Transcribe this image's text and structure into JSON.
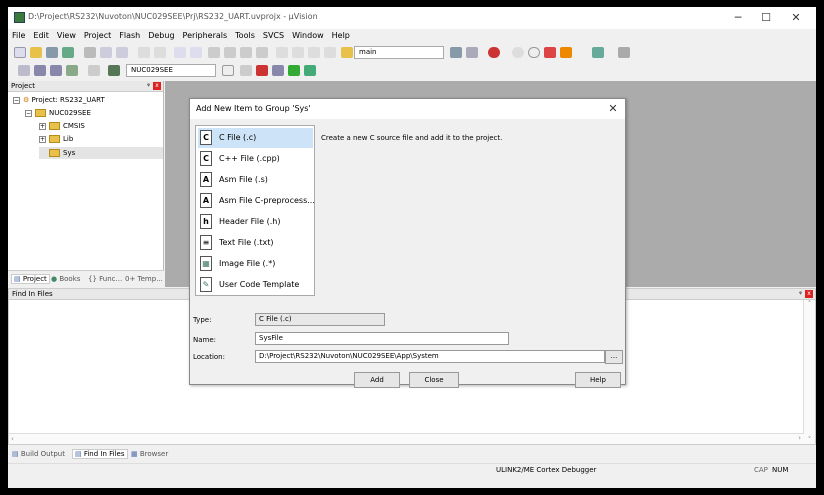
{
  "window": {
    "title": "D:\\Project\\RS232\\Nuvoton\\NUC029SEE\\Prj\\RS232_UART.uvprojx - µVision"
  },
  "menu": [
    "File",
    "Edit",
    "View",
    "Project",
    "Flash",
    "Debug",
    "Peripherals",
    "Tools",
    "SVCS",
    "Window",
    "Help"
  ],
  "toolbar": {
    "find_combo": "main",
    "target_combo": "NUC029SEE"
  },
  "project_pane": {
    "title": "Project",
    "root": "Project: RS232_UART",
    "target": "NUC029SEE",
    "groups": [
      "CMSIS",
      "Lib",
      "Sys"
    ]
  },
  "left_tabs": [
    "Project",
    "Books",
    "{} Func...",
    "0+ Temp..."
  ],
  "find_pane": {
    "title": "Find In Files"
  },
  "bottom_tabs": [
    "Build Output",
    "Find In Files",
    "Browser"
  ],
  "status": {
    "debugger": "ULINK2/ME Cortex Debugger",
    "caps": "CAP",
    "num": "NUM"
  },
  "dialog": {
    "title": "Add New Item to Group 'Sys'",
    "items": [
      {
        "icon": "C",
        "label": "C File (.c)"
      },
      {
        "icon": "C",
        "label": "C++ File (.cpp)"
      },
      {
        "icon": "A",
        "label": "Asm File (.s)"
      },
      {
        "icon": "A",
        "label": "Asm File C-preprocess..."
      },
      {
        "icon": "h",
        "label": "Header File (.h)"
      },
      {
        "icon": "≡",
        "label": "Text File (.txt)"
      },
      {
        "icon": "▦",
        "label": "Image File (.*)"
      },
      {
        "icon": "✎",
        "label": "User Code Template"
      }
    ],
    "description": "Create a new C source file and add it to the project.",
    "type_label": "Type:",
    "type_value": "C File (.c)",
    "name_label": "Name:",
    "name_value": "SysFile",
    "location_label": "Location:",
    "location_value": "D:\\Project\\RS232\\Nuvoton\\NUC029SEE\\App\\System",
    "browse": "...",
    "add": "Add",
    "close": "Close",
    "help": "Help"
  }
}
